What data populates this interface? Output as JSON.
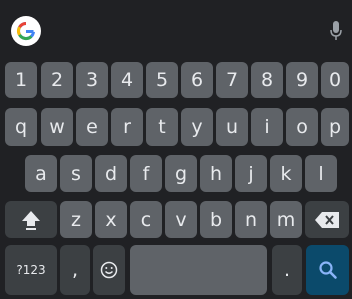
{
  "rows": {
    "numbers": [
      "1",
      "2",
      "3",
      "4",
      "5",
      "6",
      "7",
      "8",
      "9",
      "0"
    ],
    "row1": [
      "q",
      "w",
      "e",
      "r",
      "t",
      "y",
      "u",
      "i",
      "o",
      "p"
    ],
    "row2": [
      "a",
      "s",
      "d",
      "f",
      "g",
      "h",
      "j",
      "k",
      "l"
    ],
    "row3": [
      "z",
      "x",
      "c",
      "v",
      "b",
      "n",
      "m"
    ]
  },
  "bottom": {
    "symbols_label": "?123",
    "comma_label": ",",
    "period_label": "."
  },
  "icons": {
    "google": "google-g-icon",
    "mic": "mic-icon",
    "shift": "shift-icon",
    "backspace": "backspace-icon",
    "emoji": "emoji-icon",
    "search": "search-icon"
  },
  "colors": {
    "background": "#202124",
    "key": "#5f6368",
    "key_dark": "#3c4043",
    "search_key": "#0b4a6b",
    "search_icon": "#8ab4f8"
  }
}
